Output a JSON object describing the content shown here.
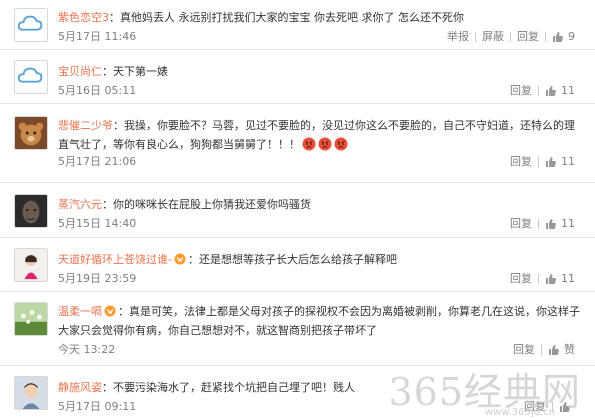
{
  "comments": [
    {
      "author": "紫色恋空3",
      "text": "：真他妈丢人 永远别打扰我们大家的宝宝 你去死吧 求你了 怎么还不死你",
      "time": "5月17日 11:46",
      "report": "举报",
      "block": "屏蔽",
      "reply": "回复",
      "likes": "9",
      "avatar": "cloud-avatar"
    },
    {
      "author": "宝贝尚仁",
      "text": "：天下第一婊",
      "time": "5月16日 05:11",
      "reply": "回复",
      "likes": "11",
      "avatar": "cloud-avatar"
    },
    {
      "author": "悲催二少爷",
      "text": "：我操，你要脸不？马蓉，见过不要脸的，没见过你这么不要脸的，自己不守妇道，还特么的理直气壮了，等你有良心么，狗狗都当舅舅了！！！",
      "time": "5月17日 21:06",
      "reply": "回复",
      "likes": "11",
      "avatar": "bear-avatar",
      "emojis": [
        "angry-emoji",
        "angry-emoji",
        "angry-emoji"
      ]
    },
    {
      "author": "蒸汽六元",
      "text": "：你的咪咪长在屁股上你猜我还爱你吗骚货",
      "time": "5月15日 14:40",
      "reply": "回复",
      "likes": "11",
      "avatar": "dark-face-avatar"
    },
    {
      "author": "天道好循环上苍饶过谁-",
      "text": "：还是想想等孩子长大后怎么给孩子解释吧",
      "time": "5月19日 23:59",
      "reply": "回复",
      "likes": "11",
      "avatar": "girl-avatar",
      "badge": "vip-icon"
    },
    {
      "author": "温柔一嗝",
      "text": "：真是可笑，法律上都是父母对孩子的探视权不会因为离婚被剥削，你算老几在这说，你这样子大家只会觉得你有病，你自己想想对不，就这智商别把孩子带坏了",
      "time": "今天 13:22",
      "reply": "回复",
      "likes": "赞",
      "avatar": "flower-avatar",
      "badge": "vip-icon"
    },
    {
      "author": "静施风姿",
      "text": "：不要污染海水了，赶紧找个坑把自己埋了吧！贱人",
      "time": "5月17日 09:11",
      "reply": "回复",
      "likes": "",
      "avatar": "child-avatar"
    }
  ],
  "watermark": {
    "text": "365经典网",
    "url": "www.365jd.cn"
  },
  "colors": {
    "author": "#eb7350",
    "meta": "#808080",
    "divider": "#e6e6e6"
  }
}
